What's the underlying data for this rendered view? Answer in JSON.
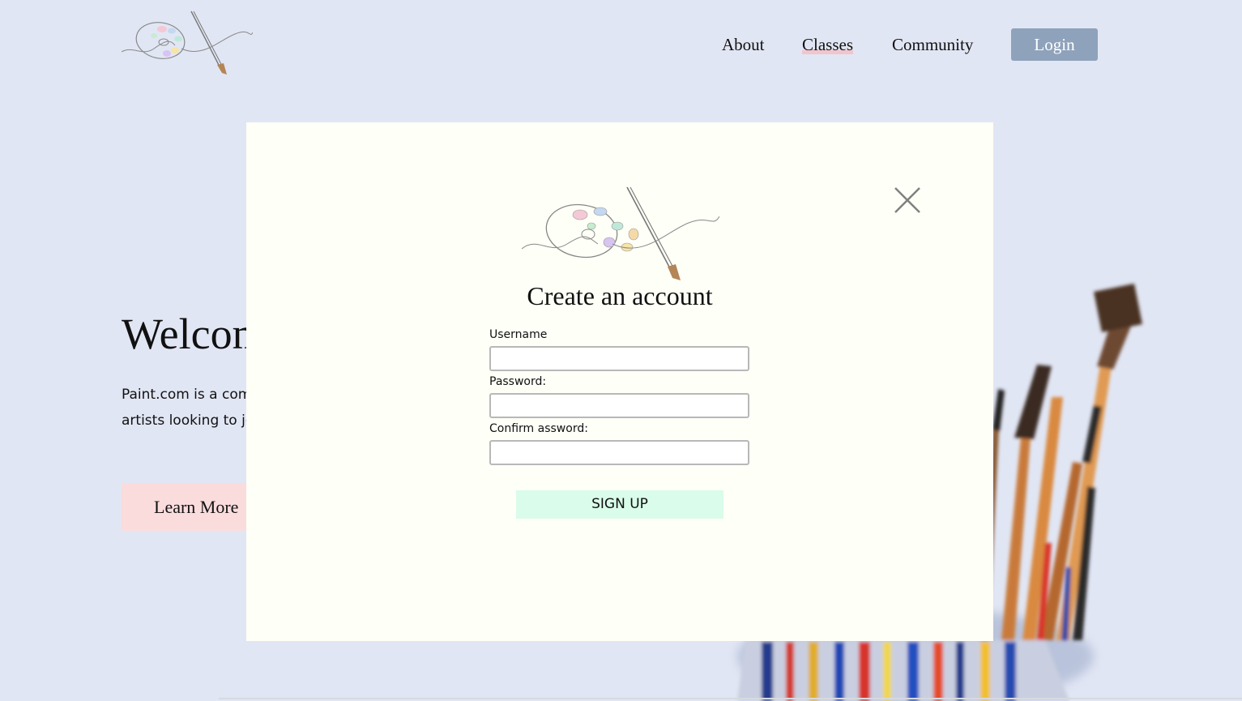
{
  "header": {
    "logo_icon": "palette-brush-icon",
    "nav": [
      {
        "label": "About"
      },
      {
        "label": "Classes"
      },
      {
        "label": "Community"
      }
    ],
    "login_label": "Login"
  },
  "hero": {
    "title": "Welcome",
    "text": "Paint.com is a community of artists, for artists looking to join forums.",
    "learn_more_label": "Learn More"
  },
  "modal": {
    "logo_icon": "palette-brush-icon",
    "close_icon": "close-icon",
    "title": "Create an account",
    "fields": [
      {
        "label": "Username",
        "value": ""
      },
      {
        "label": "Password:",
        "value": ""
      },
      {
        "label": "Confirm assword:",
        "value": ""
      }
    ],
    "submit_label": "SIGN UP"
  },
  "colors": {
    "page_background": "#e1e6f4",
    "modal_background": "#fefff7",
    "login_button": "#8fa2bb",
    "learn_more_button": "#fbdcdd",
    "signup_button": "#dafcea"
  }
}
